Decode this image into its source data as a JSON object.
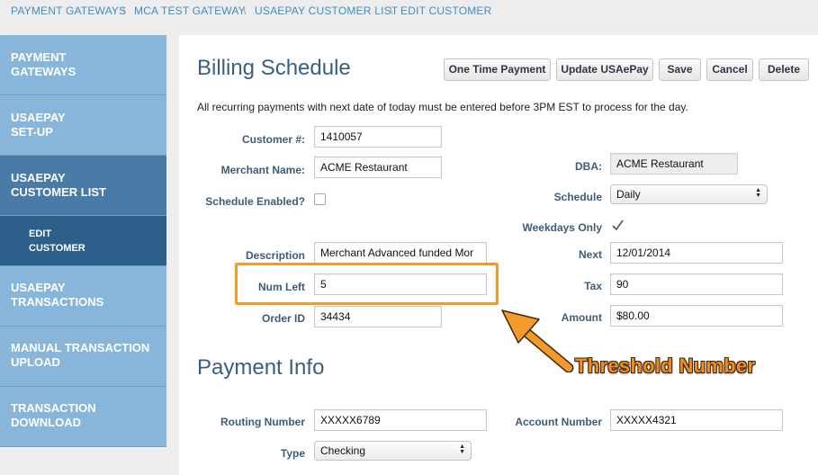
{
  "breadcrumb": {
    "items": [
      "PAYMENT GATEWAYS",
      "MCA TEST GATEWAY",
      "USAEPAY CUSTOMER LIST",
      "EDIT CUSTOMER"
    ],
    "separator": "\\"
  },
  "sidebar": {
    "items": [
      {
        "label": "PAYMENT\nGATEWAYS"
      },
      {
        "label": "USAEPAY\nSET-UP"
      },
      {
        "label": "USAEPAY\nCUSTOMER LIST"
      },
      {
        "label": "EDIT\nCUSTOMER"
      },
      {
        "label": "USAEPAY\nTRANSACTIONS"
      },
      {
        "label": "MANUAL TRANSACTION\nUPLOAD"
      },
      {
        "label": "TRANSACTION\nDOWNLOAD"
      }
    ]
  },
  "main": {
    "title": "Billing Schedule",
    "payment_title": "Payment Info",
    "notice": "All recurring payments with next date of today must be entered before 3PM EST to process for the day.",
    "buttons": {
      "one_time": "One Time Payment",
      "update": "Update USAePay",
      "save": "Save",
      "cancel": "Cancel",
      "delete": "Delete"
    },
    "fields": {
      "customer_label": "Customer #:",
      "customer_value": "1410057",
      "merchant_label": "Merchant Name:",
      "merchant_value": "ACME Restaurant",
      "dba_label": "DBA:",
      "dba_value": "ACME Restaurant",
      "schedule_enabled_label": "Schedule Enabled?",
      "schedule_label": "Schedule",
      "schedule_value": "Daily",
      "weekdays_label": "Weekdays Only",
      "description_label": "Description",
      "description_value": "Merchant Advanced funded Mor",
      "next_label": "Next",
      "next_value": "12/01/2014",
      "num_left_label": "Num Left",
      "num_left_value": "5",
      "tax_label": "Tax",
      "tax_value": "90",
      "order_label": "Order ID",
      "order_value": "34434",
      "amount_label": "Amount",
      "amount_value": "$80.00",
      "routing_label": "Routing Number",
      "routing_value": "XXXXX6789",
      "account_label": "Account Number",
      "account_value": "XXXXX4321",
      "type_label": "Type",
      "type_value": "Checking"
    },
    "schedule_enabled_checked": false,
    "weekdays_checked": true
  },
  "annotation": {
    "text": "Threshold Number",
    "color": "#f18c1e"
  },
  "colors": {
    "sidebar": "#88b6db",
    "sidebar_active": "#4a7aa6",
    "sidebar_sub": "#2c5f89",
    "heading": "#3a5f82",
    "link": "#3f8fc1",
    "highlight": "#f39a2a"
  }
}
